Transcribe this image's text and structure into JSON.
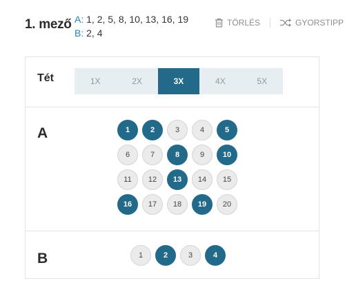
{
  "header": {
    "title": "1. mező",
    "selections": [
      {
        "key": "A:",
        "values": "1, 2, 5, 8, 10, 13, 16, 19"
      },
      {
        "key": "B:",
        "values": "2, 4"
      }
    ],
    "delete_label": "TÖRLÉS",
    "quickpick_label": "GYORSTIPP",
    "delete_icon": "trash-icon",
    "quickpick_icon": "shuffle-icon"
  },
  "stake": {
    "label": "Tét",
    "options": [
      "1X",
      "2X",
      "3X",
      "4X",
      "5X"
    ],
    "selected": "3X"
  },
  "section_a": {
    "label": "A",
    "numbers": [
      1,
      2,
      3,
      4,
      5,
      6,
      7,
      8,
      9,
      10,
      11,
      12,
      13,
      14,
      15,
      16,
      17,
      18,
      19,
      20
    ],
    "selected": [
      1,
      2,
      5,
      8,
      10,
      13,
      16,
      19
    ]
  },
  "section_b": {
    "label": "B",
    "numbers": [
      1,
      2,
      3,
      4
    ],
    "selected": [
      2,
      4
    ]
  },
  "colors": {
    "selected_ball": "#236a8a",
    "accent_text": "#1f8ab5",
    "stake_bg": "#e6eef1"
  }
}
